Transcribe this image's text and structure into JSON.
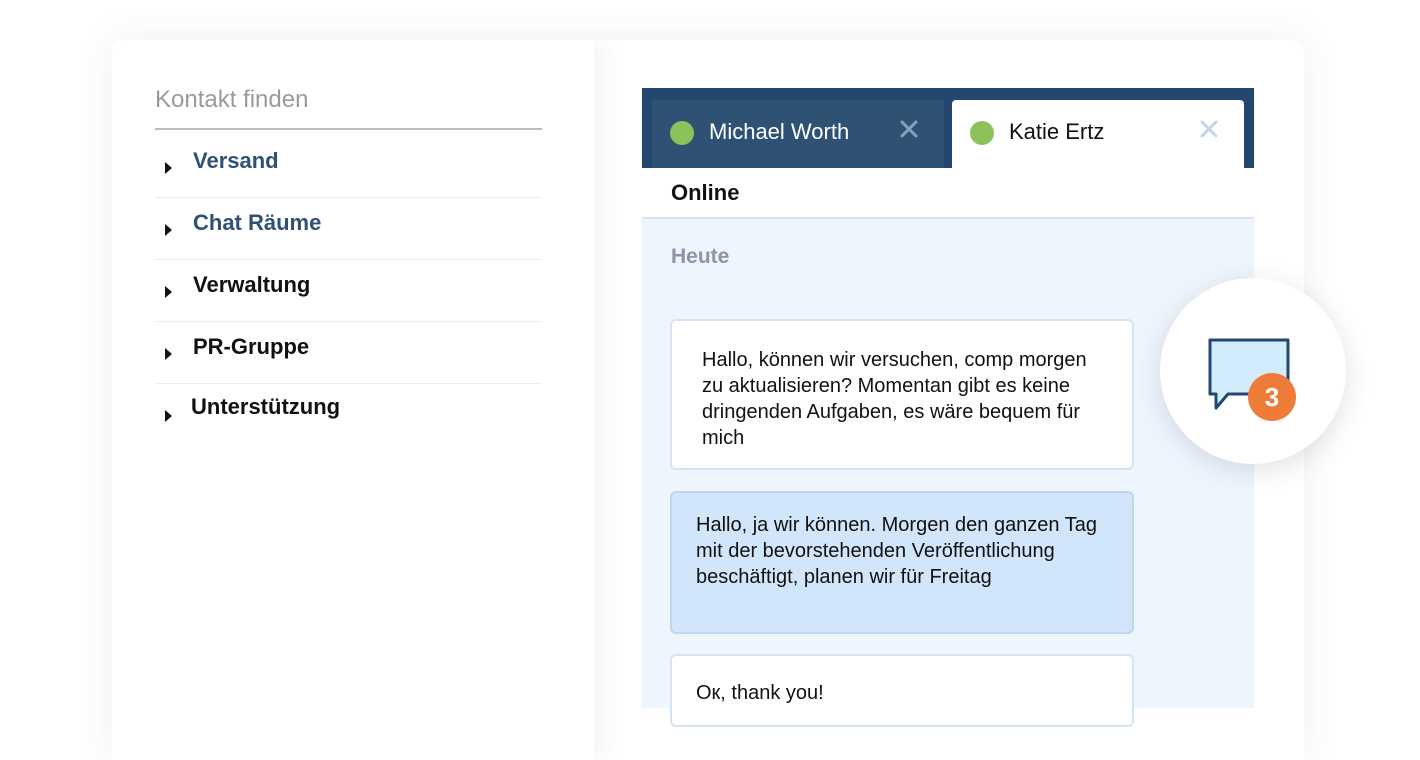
{
  "sidebar": {
    "search_placeholder": "Kontakt finden",
    "items": [
      {
        "label": "Versand"
      },
      {
        "label": "Chat Räume"
      },
      {
        "label": "Verwaltung"
      },
      {
        "label": "PR-Gruppe"
      },
      {
        "label": "Unterstützung"
      }
    ]
  },
  "chat": {
    "tabs": [
      {
        "name": "Michael Worth",
        "status_color": "#8dc15a",
        "close_icon": "close-icon"
      },
      {
        "name": "Katie Ertz",
        "status_color": "#8dc15a",
        "close_icon": "close-icon"
      }
    ],
    "status": "Online",
    "date_label": "Heute",
    "messages": [
      {
        "text": "Hallo, können wir versuchen, comp morgen zu aktualisieren? Momentan gibt es keine dringenden Aufgaben, es wäre bequem für mich",
        "direction": "incoming"
      },
      {
        "text": "Hallo, ja wir können. Morgen den ganzen Tag mit der bevorstehenden Veröffentlichung beschäftigt, planen wir für Freitag",
        "direction": "outgoing"
      },
      {
        "text": "Ок, thank you!",
        "direction": "incoming"
      }
    ]
  },
  "notification": {
    "icon": "chat-bubble-icon",
    "count": "3",
    "badge_color": "#ef7b38"
  },
  "colors": {
    "tabbar": "#24476f",
    "accent_text": "#2e5174",
    "chat_background": "#eef5fd",
    "outgoing_bubble": "#d1e6fb"
  }
}
